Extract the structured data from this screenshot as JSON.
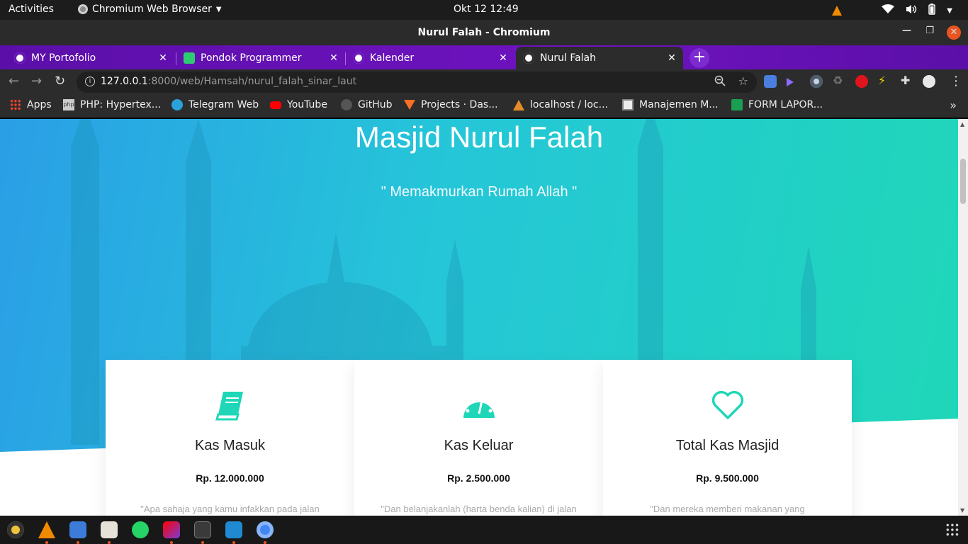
{
  "system_bar": {
    "activities": "Activities",
    "app_name": "Chromium Web Browser",
    "clock": "Okt 12  12:49"
  },
  "window": {
    "title": "Nurul Falah - Chromium"
  },
  "tabs": [
    {
      "label": "MY Portofolio",
      "icon": "globe-icon"
    },
    {
      "label": "Pondok Programmer",
      "icon": "code-braces-icon"
    },
    {
      "label": "Kalender",
      "icon": "globe-icon"
    },
    {
      "label": "Nurul Falah",
      "icon": "globe-icon",
      "active": true
    }
  ],
  "address_bar": {
    "host": "127.0.0.1",
    "path": ":8000/web/Hamsah/nurul_falah_sinar_laut"
  },
  "bookmarks": [
    {
      "label": "Apps",
      "icon": "apps-grid-icon"
    },
    {
      "label": "PHP: Hypertex...",
      "icon": "php-icon"
    },
    {
      "label": "Telegram Web",
      "icon": "telegram-icon"
    },
    {
      "label": "YouTube",
      "icon": "youtube-icon"
    },
    {
      "label": "GitHub",
      "icon": "github-icon"
    },
    {
      "label": "Projects · Das...",
      "icon": "gitlab-icon"
    },
    {
      "label": "localhost / loc...",
      "icon": "phpmyadmin-icon"
    },
    {
      "label": "Manajemen M...",
      "icon": "page-icon"
    },
    {
      "label": "FORM LAPOR...",
      "icon": "google-forms-icon"
    }
  ],
  "page": {
    "title": "Masjid Nurul Falah",
    "tagline": "\" Memakmurkan Rumah Allah \"",
    "cards": [
      {
        "icon": "book-icon",
        "title": "Kas Masuk",
        "value": "Rp. 12.000.000",
        "quote": "\"Apa sahaja yang kamu infakkan pada jalan"
      },
      {
        "icon": "speedometer-icon",
        "title": "Kas Keluar",
        "value": "Rp. 2.500.000",
        "quote": "\"Dan belanjakanlah (harta benda kalian) di jalan"
      },
      {
        "icon": "heart-icon",
        "title": "Total Kas Masjid",
        "value": "Rp. 9.500.000",
        "quote": "\"Dan mereka memberi makanan yang"
      }
    ]
  },
  "colors": {
    "accent": "#1fd7b8",
    "hero_start": "#2a9ee6",
    "hero_end": "#1fd7b8",
    "tabstrip": "#6f13c0",
    "ubuntu_orange": "#e95420"
  }
}
